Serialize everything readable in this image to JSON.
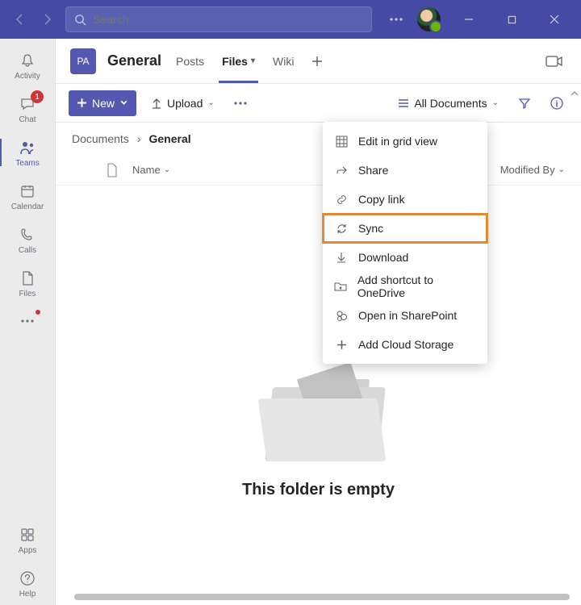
{
  "search": {
    "placeholder": "Search"
  },
  "rail": {
    "items": [
      {
        "label": "Activity"
      },
      {
        "label": "Chat",
        "badge": "1"
      },
      {
        "label": "Teams"
      },
      {
        "label": "Calendar"
      },
      {
        "label": "Calls"
      },
      {
        "label": "Files"
      }
    ],
    "apps": "Apps",
    "help": "Help"
  },
  "channel": {
    "team_abbr": "PA",
    "title": "General",
    "tabs": {
      "posts": "Posts",
      "files": "Files",
      "wiki": "Wiki"
    }
  },
  "toolbar": {
    "new": "New",
    "upload": "Upload",
    "view": "All Documents"
  },
  "breadcrumb": {
    "root": "Documents",
    "current": "General"
  },
  "columns": {
    "name": "Name",
    "modified_by": "Modified By"
  },
  "empty": {
    "text": "This folder is empty"
  },
  "menu": {
    "items": [
      "Edit in grid view",
      "Share",
      "Copy link",
      "Sync",
      "Download",
      "Add shortcut to OneDrive",
      "Open in SharePoint",
      "Add Cloud Storage"
    ],
    "highlighted": "Sync"
  }
}
